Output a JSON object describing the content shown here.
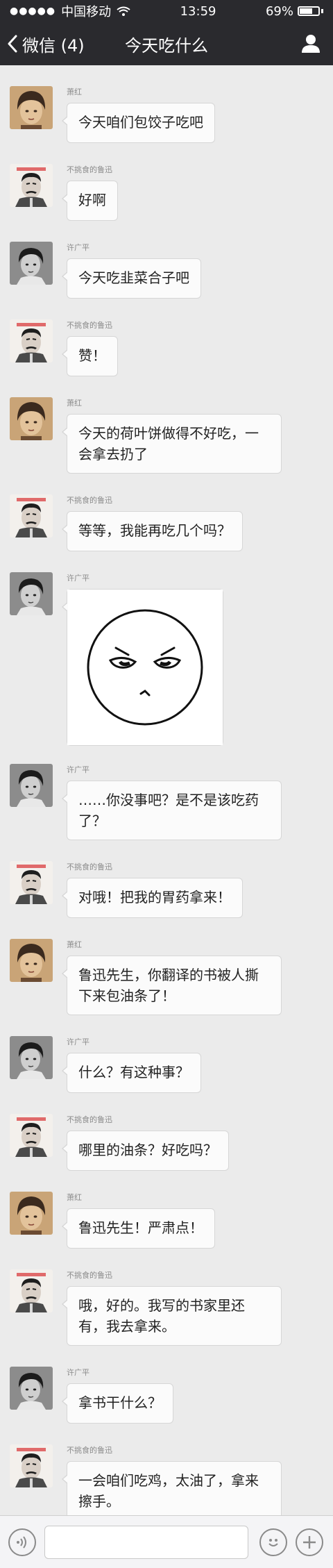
{
  "status_bar": {
    "signal_dots": "●●●●●",
    "carrier": "中国移动",
    "time": "13:59",
    "battery": "69%",
    "battery_level": 0.69
  },
  "nav": {
    "back_label": "微信 (4)",
    "title": "今天吃什么"
  },
  "messages": [
    {
      "sender": "萧红",
      "text": "今天咱们包饺子吃吧"
    },
    {
      "sender": "不挑食的鲁迅",
      "text": "好啊"
    },
    {
      "sender": "许广平",
      "text": "今天吃韭菜合子吧"
    },
    {
      "sender": "不挑食的鲁迅",
      "text": "赞！"
    },
    {
      "sender": "萧红",
      "text": "今天的荷叶饼做得不好吃，一会拿去扔了"
    },
    {
      "sender": "不挑食的鲁迅",
      "text": "等等，我能再吃几个吗？"
    },
    {
      "sender": "许广平",
      "text": "",
      "sticker": "annoyed-face-sticker"
    },
    {
      "sender": "许广平",
      "text": "……你没事吧？是不是该吃药了？"
    },
    {
      "sender": "不挑食的鲁迅",
      "text": "对哦！把我的胃药拿来！"
    },
    {
      "sender": "萧红",
      "text": "鲁迅先生，你翻译的书被人撕下来包油条了！"
    },
    {
      "sender": "许广平",
      "text": "什么？有这种事？"
    },
    {
      "sender": "不挑食的鲁迅",
      "text": "哪里的油条？好吃吗？"
    },
    {
      "sender": "萧红",
      "text": "鲁迅先生！严肃点！"
    },
    {
      "sender": "不挑食的鲁迅",
      "text": "哦，好的。我写的书家里还有，我去拿来。"
    },
    {
      "sender": "许广平",
      "text": "拿书干什么？"
    },
    {
      "sender": "不挑食的鲁迅",
      "text": "一会咱们吃鸡，太油了，拿来擦手。"
    }
  ],
  "input_bar": {
    "voice_icon": "voice-icon",
    "emoji_icon": "emoji-icon",
    "plus_icon": "plus-icon",
    "placeholder": ""
  },
  "colors": {
    "navbar": "#2a2a2e",
    "chat_bg": "#ebebeb",
    "bubble": "#fbfbfb"
  }
}
